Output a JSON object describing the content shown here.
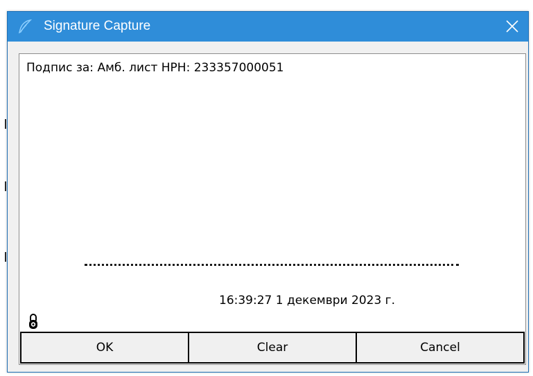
{
  "window": {
    "title": "Signature Capture",
    "app_icon": "feather-pen-icon",
    "close_icon": "close-icon",
    "titlebar_color": "#2f8dd9"
  },
  "signature": {
    "caption": "Подпис за: Амб. лист НРН: 233357000051",
    "timestamp": "16:39:27 1 декември 2023 г.",
    "lock_icon": "padlock-icon"
  },
  "buttons": {
    "ok_label": "OK",
    "clear_label": "Clear",
    "cancel_label": "Cancel"
  }
}
